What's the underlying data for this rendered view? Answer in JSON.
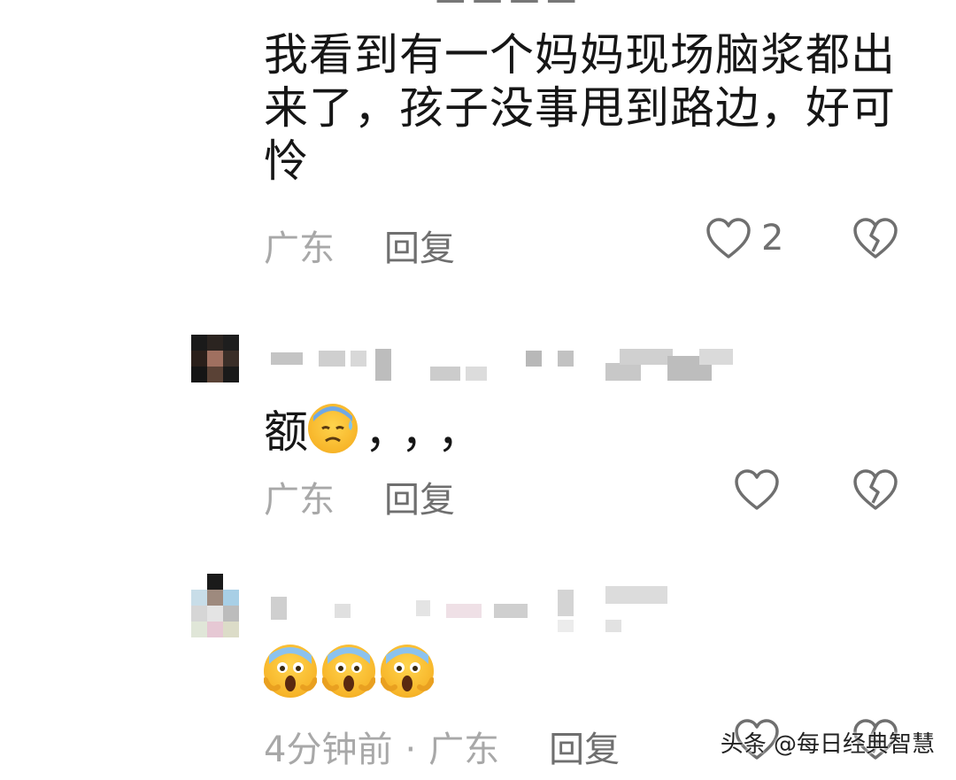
{
  "top_cut_text": "",
  "comments": [
    {
      "text": "我看到有一个妈妈现场脑浆都出来了，孩子没事甩到路边，好可怜",
      "location": "广东",
      "reply_label": "回复",
      "like_count": "2"
    },
    {
      "text": "额",
      "emoji": "😰",
      "trailing": "，，，",
      "location": "广东",
      "reply_label": "回复",
      "like_count": ""
    },
    {
      "emoji_text": "😱😱😱",
      "time": "4分钟前",
      "separator": "·",
      "location": "广东",
      "reply_label": "回复"
    }
  ],
  "watermark": "头条 @每日经典智慧",
  "icons": {
    "like": "heart-outline-icon",
    "dislike": "broken-heart-icon"
  },
  "colors": {
    "text": "#161616",
    "meta": "#a8a8a8",
    "reply": "#6f6f6f"
  }
}
